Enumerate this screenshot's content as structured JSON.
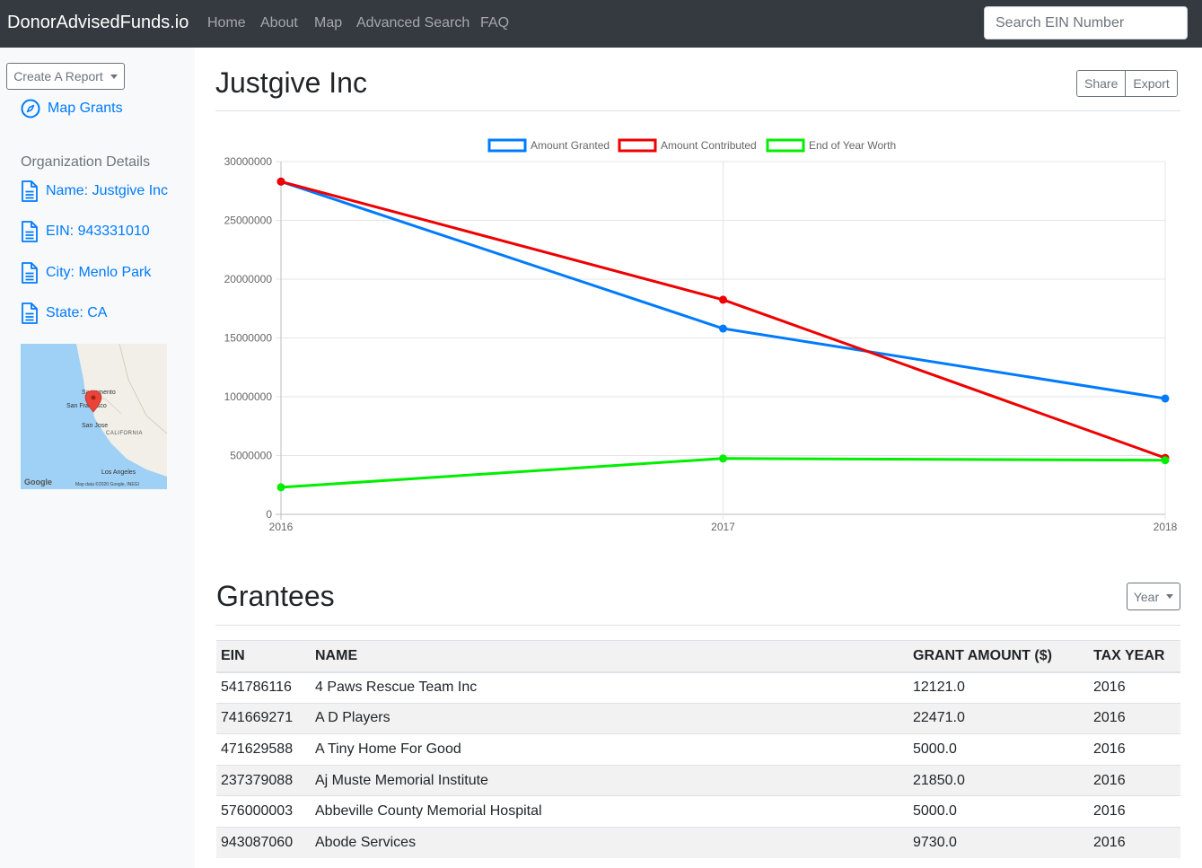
{
  "navbar": {
    "brand": "DonorAdvisedFunds.io",
    "links": [
      "Home",
      "About",
      "Map",
      "Advanced Search",
      "FAQ"
    ],
    "search_placeholder": "Search EIN Number"
  },
  "sidebar": {
    "create_report_label": "Create A Report",
    "map_grants_label": "Map Grants",
    "section_heading": "Organization Details",
    "details": [
      {
        "label": "Name: Justgive Inc"
      },
      {
        "label": "EIN: 943331010"
      },
      {
        "label": "City: Menlo Park"
      },
      {
        "label": "State: CA"
      }
    ],
    "map": {
      "labels": [
        "Sacramento",
        "San Francisco",
        "San Jose",
        "CALIFORNIA",
        "Los Angeles"
      ],
      "brand": "Google",
      "attribution": "Map data ©2020 Google, INEGI"
    }
  },
  "header": {
    "title": "Justgive Inc",
    "share_label": "Share",
    "export_label": "Export"
  },
  "chart_data": {
    "type": "line",
    "x": [
      "2016",
      "2017",
      "2018"
    ],
    "ylim": [
      0,
      30000000
    ],
    "yticks": [
      0,
      5000000,
      10000000,
      15000000,
      20000000,
      25000000,
      30000000
    ],
    "grid": true,
    "legend_position": "top",
    "series": [
      {
        "name": "Amount Granted",
        "color": "#007bff",
        "values": [
          28300000,
          15800000,
          9850000
        ]
      },
      {
        "name": "Amount Contributed",
        "color": "#ee0000",
        "values": [
          28300000,
          18250000,
          4800000
        ]
      },
      {
        "name": "End of Year Worth",
        "color": "#00ee00",
        "values": [
          2300000,
          4750000,
          4600000
        ]
      }
    ]
  },
  "grantees": {
    "title": "Grantees",
    "year_label": "Year",
    "columns": [
      "EIN",
      "NAME",
      "GRANT AMOUNT ($)",
      "TAX YEAR"
    ],
    "rows": [
      [
        "541786116",
        "4 Paws Rescue Team Inc",
        "12121.0",
        "2016"
      ],
      [
        "741669271",
        "A D Players",
        "22471.0",
        "2016"
      ],
      [
        "471629588",
        "A Tiny Home For Good",
        "5000.0",
        "2016"
      ],
      [
        "237379088",
        "Aj Muste Memorial Institute",
        "21850.0",
        "2016"
      ],
      [
        "576000003",
        "Abbeville County Memorial Hospital",
        "5000.0",
        "2016"
      ],
      [
        "943087060",
        "Abode Services",
        "9730.0",
        "2016"
      ]
    ]
  }
}
